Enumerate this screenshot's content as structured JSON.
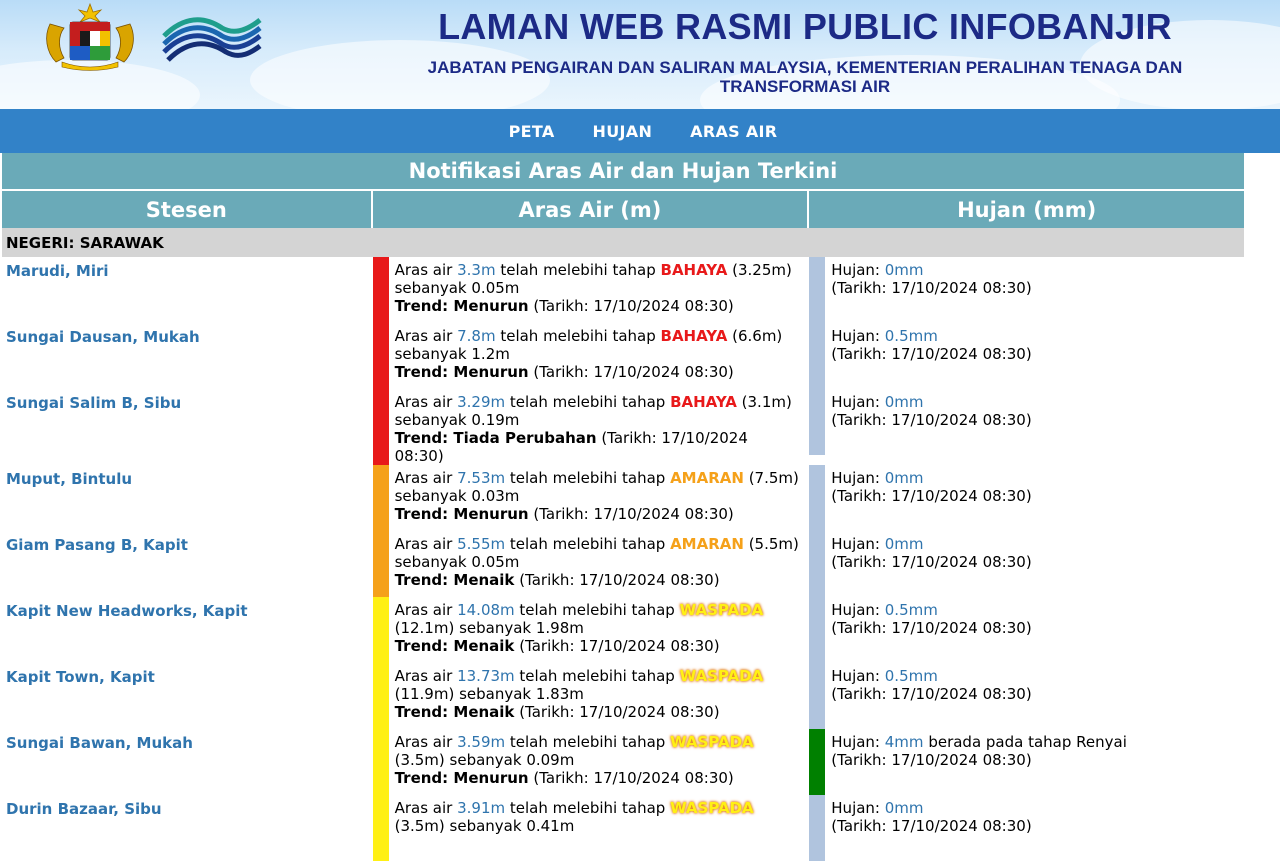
{
  "header": {
    "title": "LAMAN WEB RASMI PUBLIC INFOBANJIR",
    "subtitle": "JABATAN PENGAIRAN DAN SALIRAN MALAYSIA, KEMENTERIAN PERALIHAN TENAGA DAN TRANSFORMASI AIR",
    "crest_icon": "malaysia-coat-of-arms-icon",
    "agency_logo_icon": "jps-wave-logo-icon"
  },
  "nav": {
    "items": [
      "PETA",
      "HUJAN",
      "ARAS AIR"
    ]
  },
  "table": {
    "title": "Notifikasi Aras Air dan Hujan Terkini",
    "columns": [
      "Stesen",
      "Aras Air (m)",
      "Hujan (mm)"
    ],
    "state_label": "NEGERI: SARAWAK",
    "text": {
      "aras_prefix": "Aras air",
      "exceeded": "telah melebihi tahap",
      "by": "sebanyak",
      "trend_label": "Trend:",
      "date_label": "Tarikh:",
      "rain_label": "Hujan:",
      "rain_level_text": "berada pada tahap"
    },
    "colors": {
      "bahaya": "#e8191a",
      "amaran": "#f5a11a",
      "waspada": "#fff014",
      "rain_normal": "#b0c4de",
      "rain_renyai": "#008000"
    },
    "rows": [
      {
        "station": "Marudi, Miri",
        "level": "3.3m",
        "threshold_name": "BAHAYA",
        "threshold_value": "(3.25m)",
        "excess": "0.05m",
        "trend": "Menurun",
        "date": "17/10/2024 08:30",
        "rain": "0mm",
        "rain_level": "",
        "rain_date": "17/10/2024 08:30",
        "status": "bahaya"
      },
      {
        "station": "Sungai Dausan, Mukah",
        "level": "7.8m",
        "threshold_name": "BAHAYA",
        "threshold_value": "(6.6m)",
        "excess": "1.2m",
        "trend": "Menurun",
        "date": "17/10/2024 08:30",
        "rain": "0.5mm",
        "rain_level": "",
        "rain_date": "17/10/2024 08:30",
        "status": "bahaya"
      },
      {
        "station": "Sungai Salim B, Sibu",
        "level": "3.29m",
        "threshold_name": "BAHAYA",
        "threshold_value": "(3.1m)",
        "excess": "0.19m",
        "trend": "Tiada Perubahan",
        "date": "17/10/2024 08:30",
        "rain": "0mm",
        "rain_level": "",
        "rain_date": "17/10/2024 08:30",
        "status": "bahaya"
      },
      {
        "station": "Muput, Bintulu",
        "level": "7.53m",
        "threshold_name": "AMARAN",
        "threshold_value": "(7.5m)",
        "excess": "0.03m",
        "trend": "Menurun",
        "date": "17/10/2024 08:30",
        "rain": "0mm",
        "rain_level": "",
        "rain_date": "17/10/2024 08:30",
        "status": "amaran"
      },
      {
        "station": "Giam Pasang B, Kapit",
        "level": "5.55m",
        "threshold_name": "AMARAN",
        "threshold_value": "(5.5m)",
        "excess": "0.05m",
        "trend": "Menaik",
        "date": "17/10/2024 08:30",
        "rain": "0mm",
        "rain_level": "",
        "rain_date": "17/10/2024 08:30",
        "status": "amaran"
      },
      {
        "station": "Kapit New Headworks, Kapit",
        "level": "14.08m",
        "threshold_name": "WASPADA",
        "threshold_value": "(12.1m)",
        "excess": "1.98m",
        "trend": "Menaik",
        "date": "17/10/2024 08:30",
        "rain": "0.5mm",
        "rain_level": "",
        "rain_date": "17/10/2024 08:30",
        "status": "waspada"
      },
      {
        "station": "Kapit Town, Kapit",
        "level": "13.73m",
        "threshold_name": "WASPADA",
        "threshold_value": "(11.9m)",
        "excess": "1.83m",
        "trend": "Menaik",
        "date": "17/10/2024 08:30",
        "rain": "0.5mm",
        "rain_level": "",
        "rain_date": "17/10/2024 08:30",
        "status": "waspada"
      },
      {
        "station": "Sungai Bawan, Mukah",
        "level": "3.59m",
        "threshold_name": "WASPADA",
        "threshold_value": "(3.5m)",
        "excess": "0.09m",
        "trend": "Menurun",
        "date": "17/10/2024 08:30",
        "rain": "4mm",
        "rain_level": "Renyai",
        "rain_date": "17/10/2024 08:30",
        "status": "waspada"
      },
      {
        "station": "Durin Bazaar, Sibu",
        "level": "3.91m",
        "threshold_name": "WASPADA",
        "threshold_value": "(3.5m)",
        "excess": "0.41m",
        "trend": "",
        "date": "",
        "rain": "0mm",
        "rain_level": "",
        "rain_date": "17/10/2024 08:30",
        "status": "waspada"
      }
    ]
  }
}
